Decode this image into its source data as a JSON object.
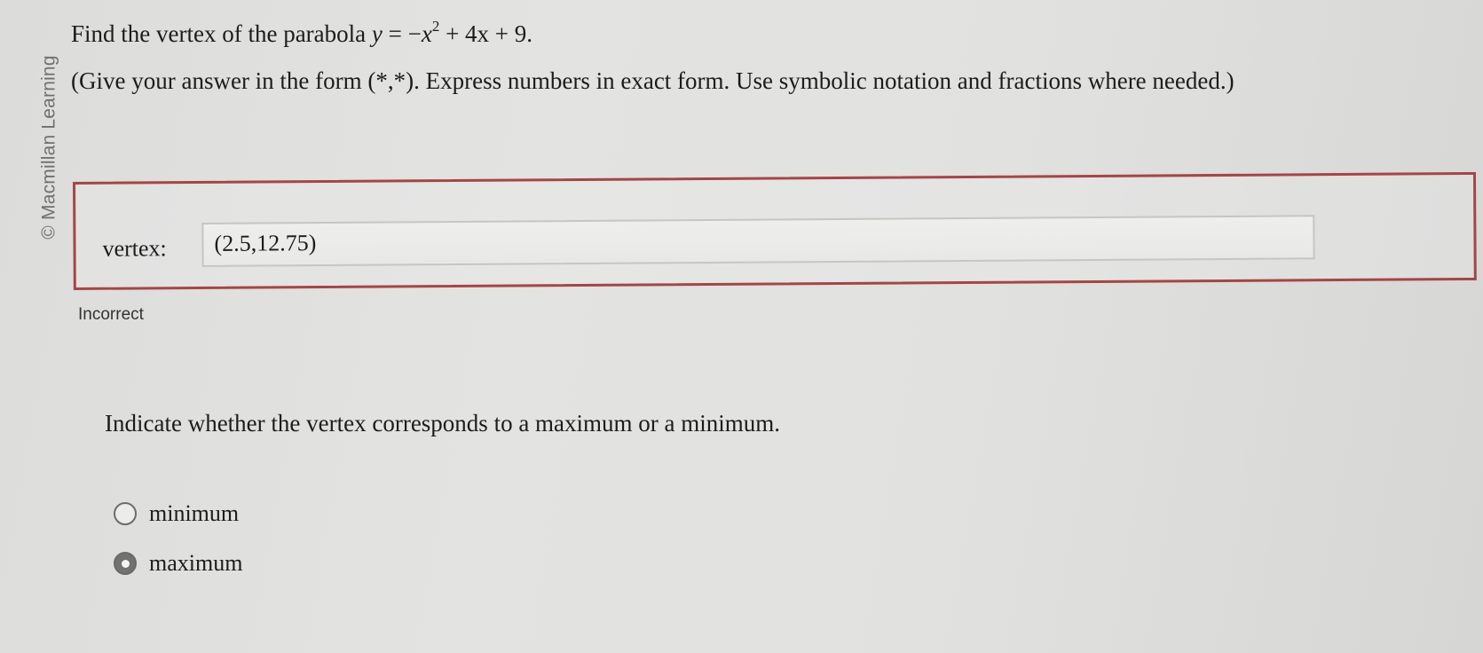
{
  "watermark": "© Macmillan Learning",
  "question": {
    "lead": "Find the vertex of the parabola",
    "equation": {
      "y": "y",
      "eq": " = −",
      "x": "x",
      "exp": "2",
      "rest": " + 4x + 9."
    },
    "instructions": "(Give your answer in the form (*,*). Express numbers in exact form. Use symbolic notation and fractions where needed.)"
  },
  "answer": {
    "label": "vertex:",
    "value": "(2.5,12.75)",
    "status": "Incorrect",
    "border_color": "#a44646"
  },
  "part2": {
    "prompt": "Indicate whether the vertex corresponds to a maximum or a minimum.",
    "options": [
      {
        "label": "minimum",
        "selected": false
      },
      {
        "label": "maximum",
        "selected": true
      }
    ]
  }
}
